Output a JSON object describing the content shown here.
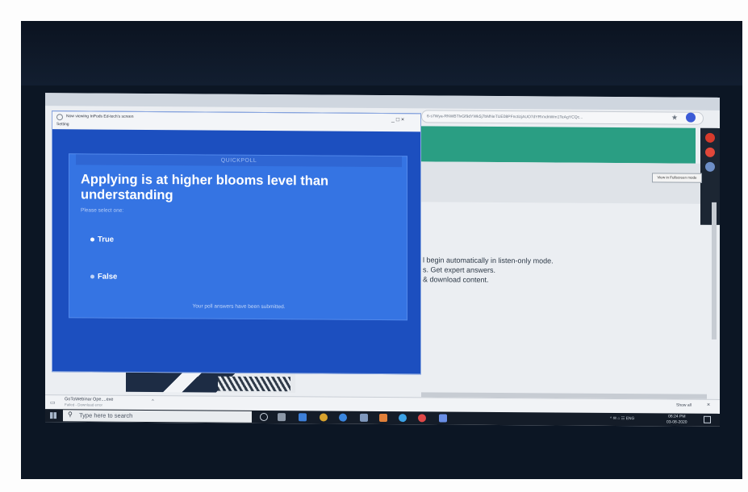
{
  "share_window": {
    "viewing_text": "Now viewing InPods Ed-tech's screen",
    "setting_text": "Setting",
    "window_controls": "_ □ ×"
  },
  "poll": {
    "header": "QUICKPOLL",
    "question": "Applying is at higher blooms level than understanding",
    "instruction": "Please select one:",
    "options": [
      {
        "label": "True",
        "selected": true
      },
      {
        "label": "False",
        "selected": false
      }
    ],
    "submitted_message": "Your poll answers have been submitted."
  },
  "browser": {
    "address": "6-s7Wya-RNWBTlvGf9dYWk5j7bMNeTUE08PFnctizjAUO7dYRVxdnWm1TeAgYCQc...",
    "fullscreen_tip": "View in Fullscreen mode",
    "webinar_lines": [
      "l begin automatically in listen-only mode.",
      "s. Get expert answers.",
      "& download content."
    ]
  },
  "downloads": {
    "file_name": "GoToWebinar Ope....exe",
    "file_status": "Failed - Download error",
    "show_all": "Show all",
    "close": "×"
  },
  "taskbar": {
    "search_placeholder": "Type here to search",
    "tray_text": "^ ✉ ⌂ ☷ ENG",
    "time": "06:24 PM",
    "date": "03-08-2020"
  },
  "colors": {
    "poll_bg": "#3574e3",
    "share_bg": "#1c4fbf",
    "banner_teal": "#2a9e83",
    "taskbar": "#141c28"
  }
}
